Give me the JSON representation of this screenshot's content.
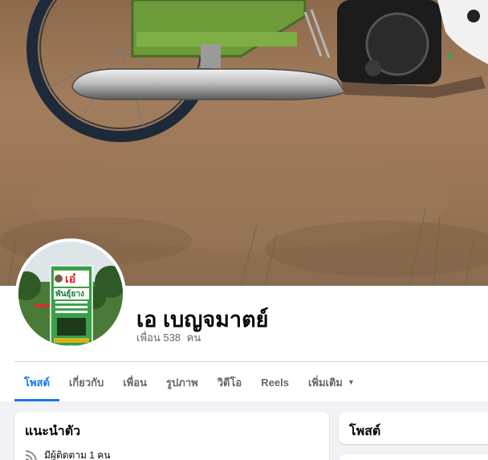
{
  "profile": {
    "name": "เอ เบญจมาตย์",
    "friends_label": "เพื่อน",
    "friends_count": "538",
    "friends_unit": "คน",
    "avatar_sign": {
      "line1": "เอ๋",
      "line2": "พันธุ์ยาง"
    }
  },
  "tabs": [
    {
      "label": "โพสต์",
      "active": true
    },
    {
      "label": "เกี่ยวกับ"
    },
    {
      "label": "เพื่อน"
    },
    {
      "label": "รูปภาพ"
    },
    {
      "label": "วิดีโอ"
    },
    {
      "label": "Reels"
    },
    {
      "label": "เพิ่มเติม",
      "icon": "caret-down-icon"
    }
  ],
  "intro": {
    "title": "แนะนำตัว",
    "follower_icon": "rss-icon",
    "follower_text": "มีผู้ติดตาม 1 คน"
  },
  "posts": {
    "title": "โพสต์"
  },
  "colors": {
    "accent": "#1877f2",
    "text_primary": "#050505",
    "text_secondary": "#65676b",
    "page_bg": "#f0f2f5"
  }
}
